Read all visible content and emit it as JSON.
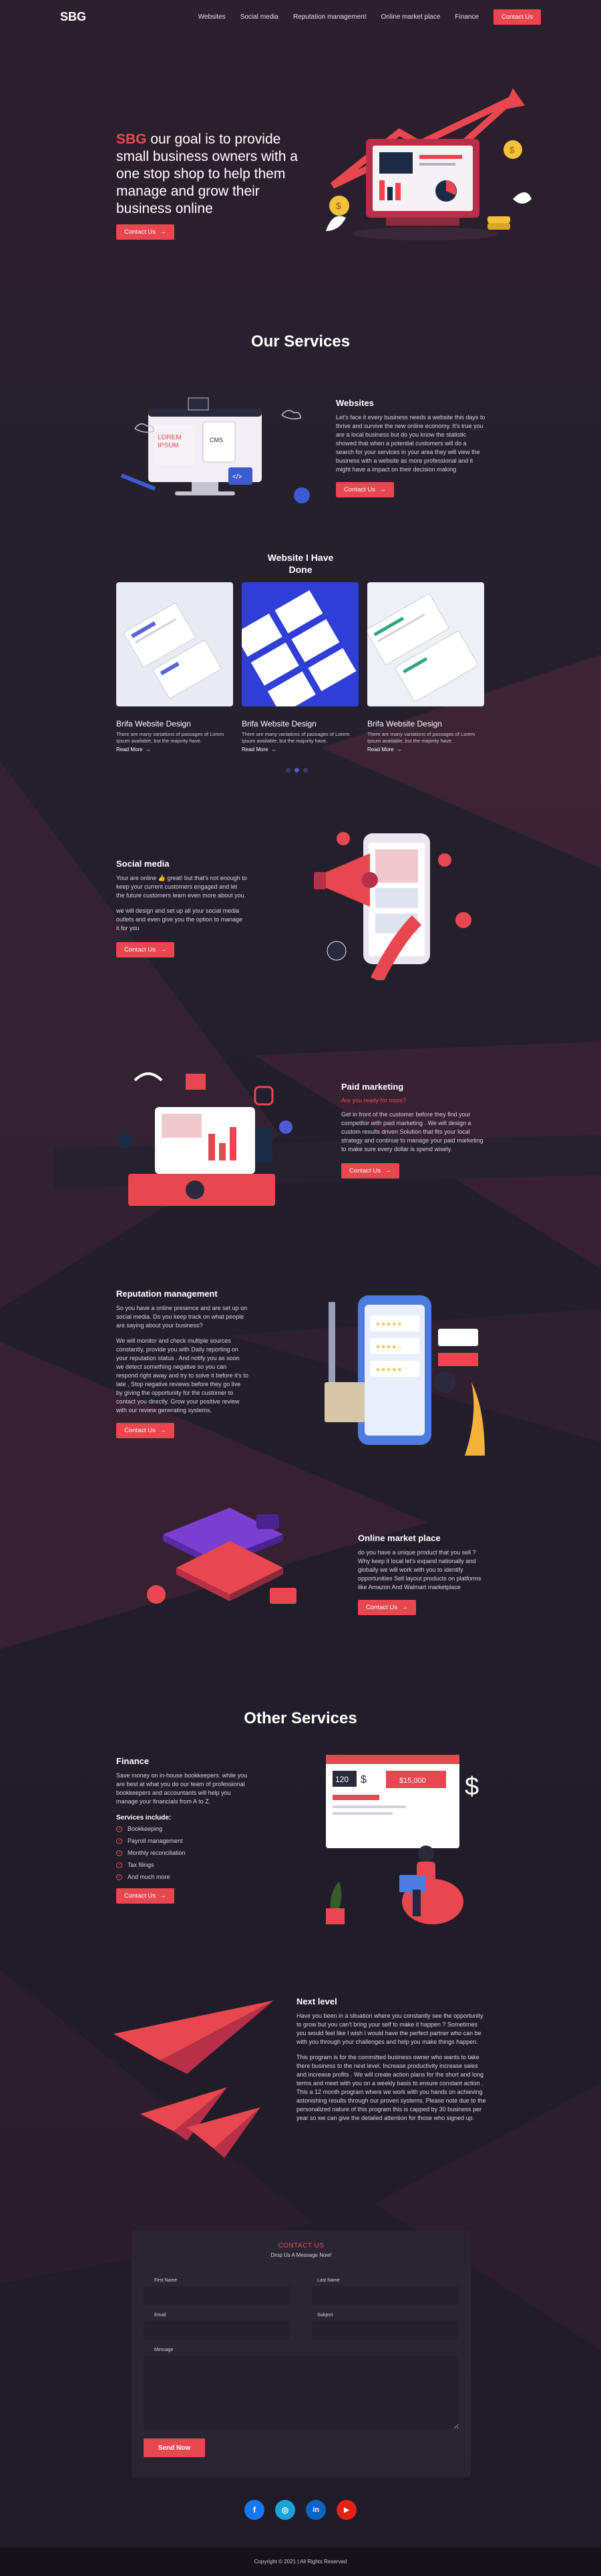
{
  "header": {
    "logo": "SBG",
    "nav": [
      "Websites",
      "Social media",
      "Reputation management",
      "Online market place",
      "Finance"
    ],
    "cta": "Contact Us"
  },
  "hero": {
    "brand": "SBG",
    "text": " our goal is to provide small business owners with a one stop shop to help them manage and grow their business online",
    "cta": "Contact Us"
  },
  "services_title": "Our Services",
  "websites": {
    "title": "Websites",
    "body": "Let's face it every business needs a website this days to thrive and survive the new online economy. It's true you are a local business but do you know the statistic showed that when a potential customers will do a search for your services in your area they will view the business with a website as more professional and it might have a impact on their decision making",
    "cta": "Contact Us"
  },
  "portfolio": {
    "title": "Website I Have Done",
    "cards": [
      {
        "title": "Brifa Website Design",
        "desc": "There are many variations of passages of Lorem Ipsum available, but the majority have.",
        "link": "Read More"
      },
      {
        "title": "Brifa Website Design",
        "desc": "There are many variations of passages of Lorem Ipsum available, but the majority have.",
        "link": "Read More"
      },
      {
        "title": "Brifa Website Design",
        "desc": "There are many variations of passages of Lorem Ipsum available, but the majority have.",
        "link": "Read More"
      }
    ]
  },
  "social_media": {
    "title": "Social media",
    "p1": "Your are online 👍 great! but that's not enough to keep your current customers engaged and let the future customers learn even more about you.",
    "p2": "we will design and set up all your social media outlets and even give you the option to manage it for you",
    "cta": "Contact Us"
  },
  "paid_marketing": {
    "title": "Paid marketing",
    "sub": "Are you ready for more?",
    "body": "Get in front of the customer before they find your competitor with paid marketing . We will design a custom results driven Solution that fits your local strategy and continue to manage your paid marketing to make sure every dollar is spend wisely.",
    "cta": "Contact Us"
  },
  "reputation": {
    "title": "Reputation management",
    "p1": "So you have a online presence and are set up on social media. Do you keep track on what people are saying about your business?",
    "p2": "We will monitor and check multiple sources constantly, provide you with Daily reporting on your reputation status . And notify you as soon we detect something negative so you can respond right away and try to solve it before it's to late , Stop negative reviews before they go live by giving the opportunity for the customer to contact you directly. Grow your positive review with our review generating systems.",
    "cta": "Contact Us"
  },
  "marketplace": {
    "title": "Online market place",
    "body": "do you have a unique product that you sell ? Why keep it local let's expand nationally and globally we will work with you to identify opportunities Sell layout products on platforms like Amazon And Walmart marketplace",
    "cta": "Contact Us"
  },
  "other_title": "Other Services",
  "finance": {
    "title": "Finance",
    "body": "Save money on in-house bookkeepers. while you are best at what you do our team of professional bookkeepers and accountants will help you manage your financials from A to Z.",
    "list_title": "Services include:",
    "items": [
      "Bookkeeping",
      "Payroll management",
      "Monthly reconciliation",
      "Tax filings",
      "And much more"
    ],
    "cta": "Contact Us",
    "art_values": [
      "120",
      "$",
      "$15,000",
      "$"
    ]
  },
  "next_level": {
    "title": "Next level",
    "p1": "Have you been in a situation where you constantly see the opportunity to grow but you can't bring your self to make it happen ? Sometimes you would feel like I wish I would have the perfect partner who can be with you through your challenges and help you make things happen.",
    "p2": "This program is for the committed business owner who wants to take there business to the next level. Increase productivity increase sales and increase profits . We will create action plans for the short and long terms and meet with you on a weekly basis to ensure constant action . This a 12 month program where we work with you hands on achieving astonishing results through our proven systems. Please note due to the personalized nature of this program this is capped by 30 business per year so we can give the detailed attention for those who signed up."
  },
  "contact": {
    "title": "CONTACT US",
    "sub": "Drop Us A Message Now!",
    "first_name": "First Name",
    "last_name": "Last Name",
    "email": "Email",
    "subject": "Subject",
    "message": "Message",
    "send": "Send Now"
  },
  "socials": [
    "f",
    "◎",
    "in",
    "▶"
  ],
  "footer": "Copyright © 2021 | All Rights Reserved",
  "colors": {
    "accent": "#e8474f",
    "bg": "#26212f",
    "facebook": "#1877f2",
    "instagram": "#c13584",
    "linkedin": "#0a66c2",
    "youtube": "#e62117"
  }
}
